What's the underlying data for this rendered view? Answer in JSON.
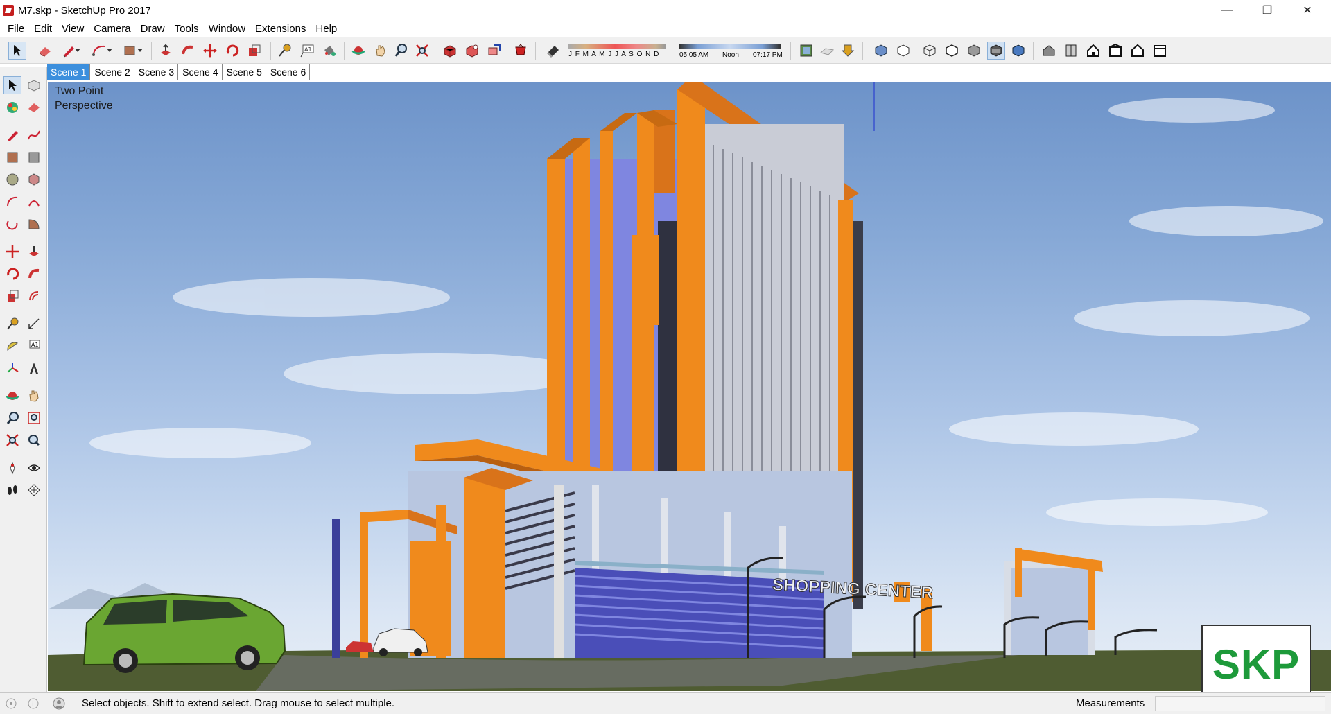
{
  "window": {
    "title": "M7.skp - SketchUp Pro 2017",
    "minimize_glyph": "—",
    "restore_glyph": "❐",
    "close_glyph": "✕"
  },
  "menu": [
    "File",
    "Edit",
    "View",
    "Camera",
    "Draw",
    "Tools",
    "Window",
    "Extensions",
    "Help"
  ],
  "shadow_settings": {
    "months": "J F M A M J J A S O N D",
    "time_start": "05:05 AM",
    "time_mid": "Noon",
    "time_end": "07:17 PM"
  },
  "scenes": [
    "Scene 1",
    "Scene 2",
    "Scene 3",
    "Scene 4",
    "Scene 5",
    "Scene 6"
  ],
  "active_scene": "Scene 1",
  "viewport": {
    "camera_label_line1": "Two Point",
    "camera_label_line2": "Perspective",
    "sign_text": "SHOPPING CENTER"
  },
  "status": {
    "message": "Select objects. Shift to extend select. Drag mouse to select multiple.",
    "measurements_label": "Measurements",
    "measurements_value": ""
  },
  "watermark": "SKP",
  "colors": {
    "accent_orange": "#f08a1c",
    "glass_blue": "#6a6fd0",
    "sky_top": "#6d93c9",
    "car_green": "#6aa632",
    "badge_green": "#1d9a3a",
    "scene_active": "#3c8fdd"
  }
}
